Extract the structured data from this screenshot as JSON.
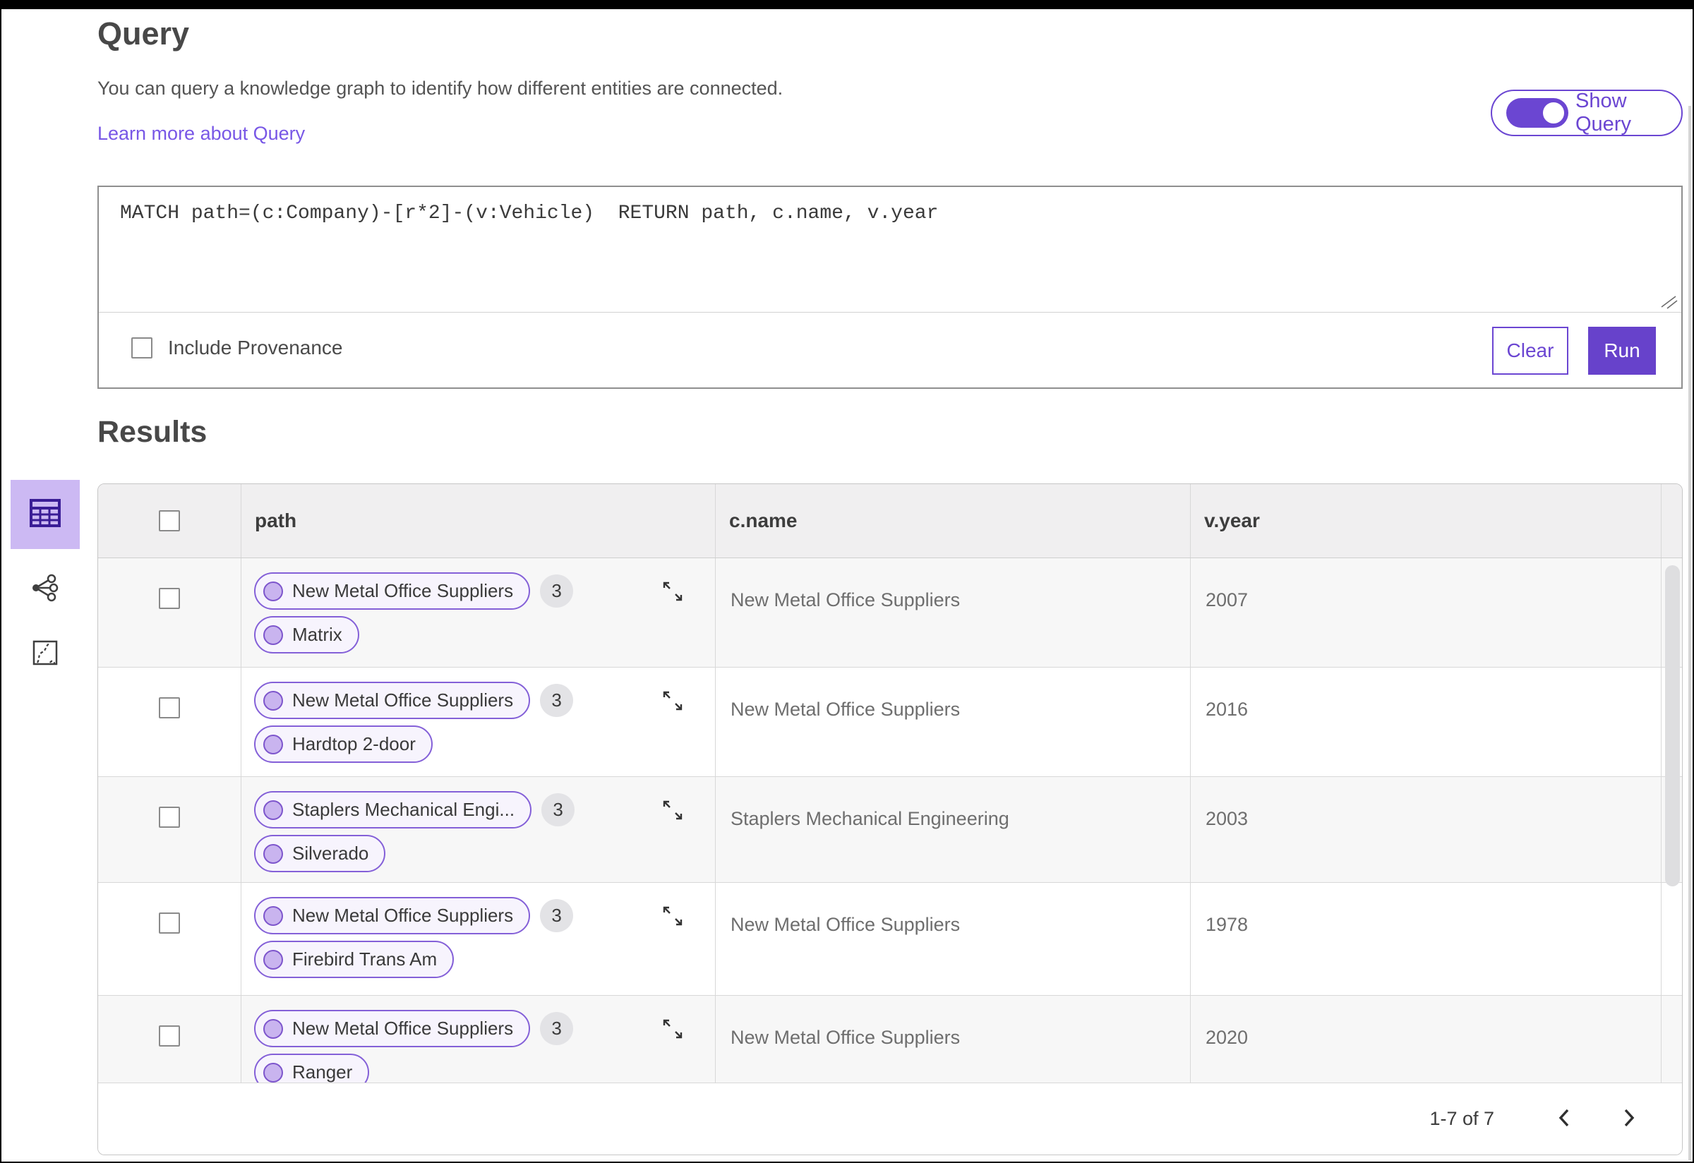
{
  "header": {
    "title": "Query",
    "description": "You can query a knowledge graph to identify how different entities are connected.",
    "learn_more_label": "Learn more about Query",
    "show_query_label": "Show Query",
    "show_query_state": "on"
  },
  "query_editor": {
    "query_text": "MATCH path=(c:Company)-[r*2]-(v:Vehicle)  RETURN path, c.name, v.year",
    "include_provenance_label": "Include Provenance",
    "include_provenance_checked": false,
    "clear_label": "Clear",
    "run_label": "Run"
  },
  "results": {
    "title": "Results",
    "view_switcher": [
      {
        "id": "table",
        "icon": "table-icon",
        "active": true
      },
      {
        "id": "graph",
        "icon": "network-icon",
        "active": false
      },
      {
        "id": "map",
        "icon": "map-route-icon",
        "active": false
      }
    ]
  },
  "table": {
    "columns": {
      "path": "path",
      "c_name": "c.name",
      "v_year": "v.year"
    },
    "rows": [
      {
        "path_nodes": [
          "New Metal Office Suppliers",
          "Matrix"
        ],
        "badge": "3",
        "c_name": "New Metal Office Suppliers",
        "v_year": "2007"
      },
      {
        "path_nodes": [
          "New Metal Office Suppliers",
          "Hardtop 2-door"
        ],
        "badge": "3",
        "c_name": "New Metal Office Suppliers",
        "v_year": "2016"
      },
      {
        "path_nodes": [
          "Staplers Mechanical Engi...",
          "Silverado"
        ],
        "badge": "3",
        "c_name": "Staplers Mechanical Engineering",
        "v_year": "2003"
      },
      {
        "path_nodes": [
          "New Metal Office Suppliers",
          "Firebird Trans Am"
        ],
        "badge": "3",
        "c_name": "New Metal Office Suppliers",
        "v_year": "1978"
      },
      {
        "path_nodes": [
          "New Metal Office Suppliers",
          "Ranger"
        ],
        "badge": "3",
        "c_name": "New Metal Office Suppliers",
        "v_year": "2020"
      }
    ]
  },
  "pagination": {
    "range_label": "1-7 of 7"
  },
  "colors": {
    "accent_purple": "#6b46d2",
    "run_button": "#6742cb",
    "link_purple": "#7857e6",
    "pill_border": "#8460d8",
    "pill_bg": "#f7f4fd",
    "node_fill": "#c9b4ef",
    "active_view_bg": "#ccb9f3",
    "active_view_glyph": "#3a1d96",
    "header_bg": "#f0eff0",
    "row_alt_bg": "#f7f7f7",
    "badge_bg": "#e3e3e6",
    "top_bar": "#000000"
  }
}
